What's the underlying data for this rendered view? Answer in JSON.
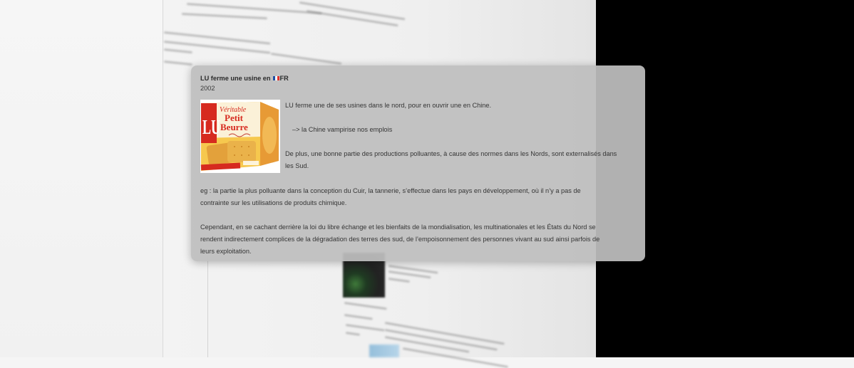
{
  "popover": {
    "title": "LU ferme une usine en",
    "flag_icon": "france-flag-icon",
    "country_code": "FR",
    "year": "2002",
    "image": {
      "icon": "lu-petit-beurre-box-image",
      "brand": "LU",
      "product_name": [
        "Véritable",
        "Petit",
        "Beurre"
      ]
    },
    "side_paragraphs": [
      {
        "lines": [
          "LU ferme une de ses usines dans le nord, pour en ouvrir une en Chine."
        ]
      },
      {
        "lines": [
          "–> la Chine vampirise nos emplois"
        ]
      },
      {
        "lines": [
          "De plus, une bonne partie des productions polluantes, à cause des normes dans les Nords, sont externalisés dans",
          "les Sud."
        ]
      }
    ],
    "paragraphs": [
      {
        "lines": [
          "eg : la partie la plus polluante dans la conception du Cuir, la tannerie, s’effectue dans les pays en développement, où il n’y a pas de",
          "contrainte sur les utilisations de produits chimique."
        ]
      },
      {
        "lines": [
          "Cependant, en se cachant derrière la loi du libre échange et les bienfaits de la mondialisation, les multinationales et les États du Nord se",
          "rendent indirectement complices de la dégradation des terres des sud, de l’empoisonnement des personnes vivant au sud ainsi parfois de",
          "leurs exploitation."
        ]
      }
    ]
  },
  "colors": {
    "card_background": "#bebebe",
    "text": "#353535",
    "background_right": "#000000",
    "lu_red": "#d62a1f",
    "box_yellow": "#f3c04a",
    "flag_blue": "#1f4fa3",
    "flag_white": "#ffffff",
    "flag_red": "#e0322c"
  }
}
